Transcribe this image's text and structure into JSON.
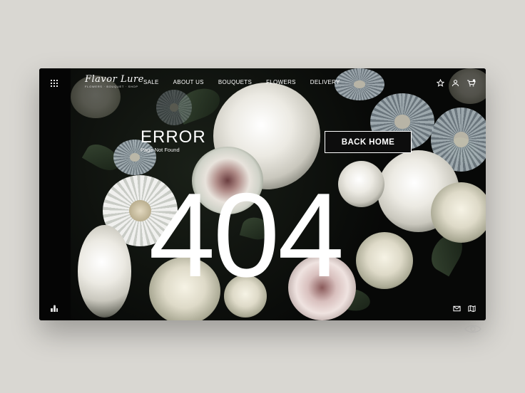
{
  "brand": {
    "name": "Flavor Lure",
    "tagline": "FLOWERS · BOUQUET · SHOP"
  },
  "nav": {
    "items": [
      {
        "label": "SALE"
      },
      {
        "label": "ABOUT US"
      },
      {
        "label": "BOUQUETS"
      },
      {
        "label": "FLOWERS"
      },
      {
        "label": "DELIVERY"
      }
    ],
    "tools": [
      "star-icon",
      "user-icon",
      "cart-icon"
    ],
    "cart_count": "0"
  },
  "error": {
    "title": "ERROR",
    "subtitle": "Page Not Found",
    "code": "404",
    "button": "BACK HOME"
  },
  "footer_icons": [
    "mail-icon",
    "map-icon"
  ],
  "colors": {
    "background": "#d9d7d2",
    "panel": "#070807",
    "text": "#ffffff",
    "button_bg": "#0d0d0d"
  }
}
